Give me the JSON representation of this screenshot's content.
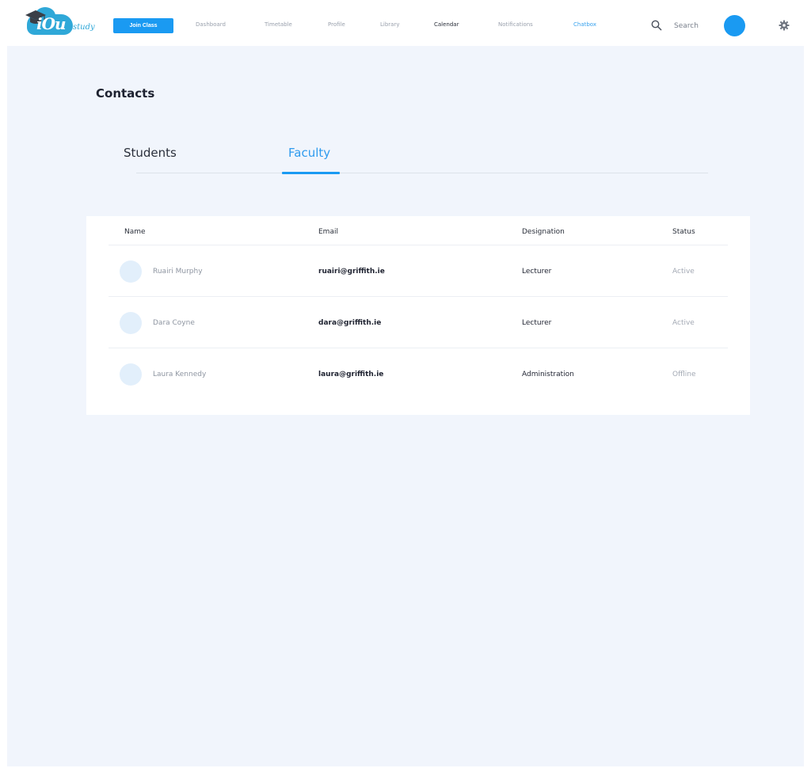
{
  "brand": {
    "logo_letters": "iOu",
    "logo_word": "study"
  },
  "nav": {
    "join_label": "Join Class",
    "items": [
      {
        "label": "Dashboard"
      },
      {
        "label": "Timetable"
      },
      {
        "label": "Profile"
      },
      {
        "label": "Library"
      },
      {
        "label": "Calendar"
      },
      {
        "label": "Notifications"
      },
      {
        "label": "Chatbox"
      }
    ],
    "search_label": "Search"
  },
  "page": {
    "title": "Contacts"
  },
  "tabs": [
    {
      "label": "Students",
      "active": false
    },
    {
      "label": "Faculty",
      "active": true
    }
  ],
  "table": {
    "columns": [
      "Name",
      "Email",
      "Designation",
      "Status"
    ],
    "rows": [
      {
        "name": "Ruairi Murphy",
        "email": "ruairi@griffith.ie",
        "designation": "Lecturer",
        "status": "Active"
      },
      {
        "name": "Dara Coyne",
        "email": "dara@griffith.ie",
        "designation": "Lecturer",
        "status": "Active"
      },
      {
        "name": "Laura Kennedy",
        "email": "laura@griffith.ie",
        "designation": "Administration",
        "status": "Offline"
      }
    ]
  },
  "colors": {
    "accent": "#1a9af2",
    "page_background": "#f1f5fc",
    "avatar_placeholder": "#e2effb",
    "logo": "#2fa8d8"
  },
  "icons": {
    "search": "search-icon",
    "settings": "gear-icon",
    "logo_cap": "graduation-cap-icon"
  }
}
